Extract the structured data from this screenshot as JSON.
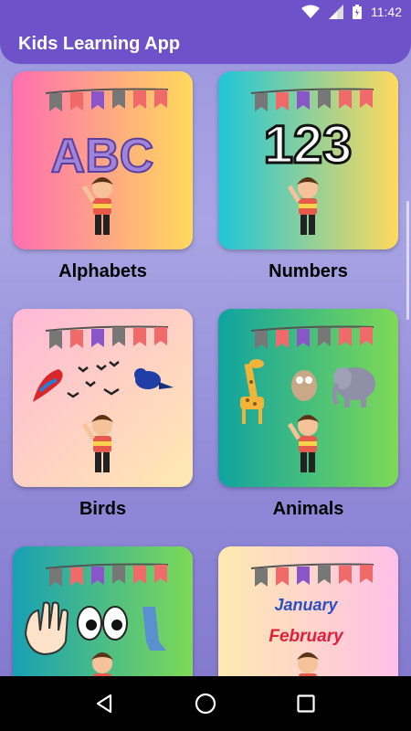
{
  "status_bar": {
    "time": "11:42",
    "icons": [
      "wifi-icon",
      "signal-icon",
      "battery-icon"
    ]
  },
  "app_bar": {
    "title": "Kids Learning App",
    "color": "#6f52c9"
  },
  "categories": [
    {
      "label": "Alphabets",
      "art_text": "ABC",
      "bg": [
        "#ff6fb0",
        "#ffd95c"
      ]
    },
    {
      "label": "Numbers",
      "art_text": "123",
      "bg": [
        "#1ec6d8",
        "#ffd95c"
      ]
    },
    {
      "label": "Birds",
      "art_text": "",
      "bg": [
        "#ffb8d8",
        "#ffe9b0"
      ]
    },
    {
      "label": "Animals",
      "art_text": "",
      "bg": [
        "#0fa3a0",
        "#7ed957"
      ]
    },
    {
      "label": "",
      "art_text": "",
      "bg": [
        "#18a0b4",
        "#7ed957"
      ]
    },
    {
      "label": "",
      "art_text": "",
      "months": [
        "January",
        "February"
      ],
      "bg": [
        "#ffe9b0",
        "#ffc0e8"
      ]
    }
  ],
  "nav_bar": {
    "buttons": [
      "back-icon",
      "home-icon",
      "recents-icon"
    ]
  }
}
